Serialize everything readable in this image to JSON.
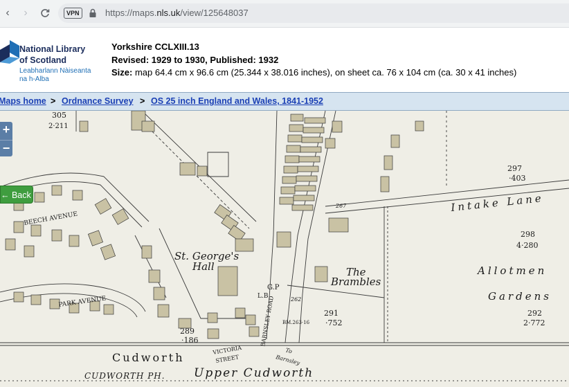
{
  "browser": {
    "vpn_label": "VPN",
    "url_prefix": "https://maps.",
    "url_domain": "nls.uk",
    "url_path": "/view/125648037"
  },
  "logo": {
    "line1": "National Library",
    "line2": "of Scotland",
    "line3": "Leabharlann Nàiseanta",
    "line4": "na h-Alba"
  },
  "sheet": {
    "title": "Yorkshire CCLXIII.13",
    "revised": "Revised: 1929 to 1930, Published: 1932",
    "size_label": "Size:",
    "size_text": " map 64.4 cm x 96.6 cm (25.344 x 38.016 inches), on sheet ca. 76 x 104 cm (ca. 30 x 41 inches)"
  },
  "breadcrumb": {
    "items": [
      "Maps home",
      "Ordnance Survey",
      "OS 25 inch England and Wales, 1841-1952"
    ],
    "separator": ">"
  },
  "map_controls": {
    "zoom_in": "+",
    "zoom_out": "−",
    "back_label": "← Back"
  },
  "map_labels": {
    "parcel_305": "305",
    "area_305": "2·211",
    "beech_avenue": "BEECH AVENUE",
    "park_avenue": "PARK AVENUE",
    "st_georges": "St. George's",
    "hall": "Hall",
    "parcel_297": "297",
    "area_297": "·403",
    "intake_lane": "Intake Lane",
    "parcel_298": "298",
    "area_298": "4·280",
    "allotments": "Allotmen",
    "gardens": "Gardens",
    "the": "The",
    "brambles": "Brambles",
    "gp": "G.P",
    "lb": "L.B",
    "barnsley_road": "BARNSLEY ROAD",
    "spot_267": "267",
    "spot_262": "262",
    "parcel_291": "291",
    "area_291": "·752",
    "bm": "BM.263·16",
    "parcel_292": "292",
    "area_292": "2·772",
    "parcel_289": "289",
    "area_289": "·186",
    "victoria_street_1": "VICTORIA",
    "victoria_street_2": "STREET",
    "to_barnsley_1": "To",
    "to_barnsley_2": "Barnsley",
    "cudworth": "Cudworth",
    "cudworth_ph": "CUDWORTH PH.",
    "upper_cudworth": "Upper Cudworth"
  },
  "colors": {
    "map_paper": "#efeee6",
    "building_fill": "#c9c2a4",
    "ink": "#1a1a1a",
    "breadcrumb_bg": "#d6e4f0",
    "link": "#1a3fb4",
    "back_button": "#3f9d3f"
  }
}
